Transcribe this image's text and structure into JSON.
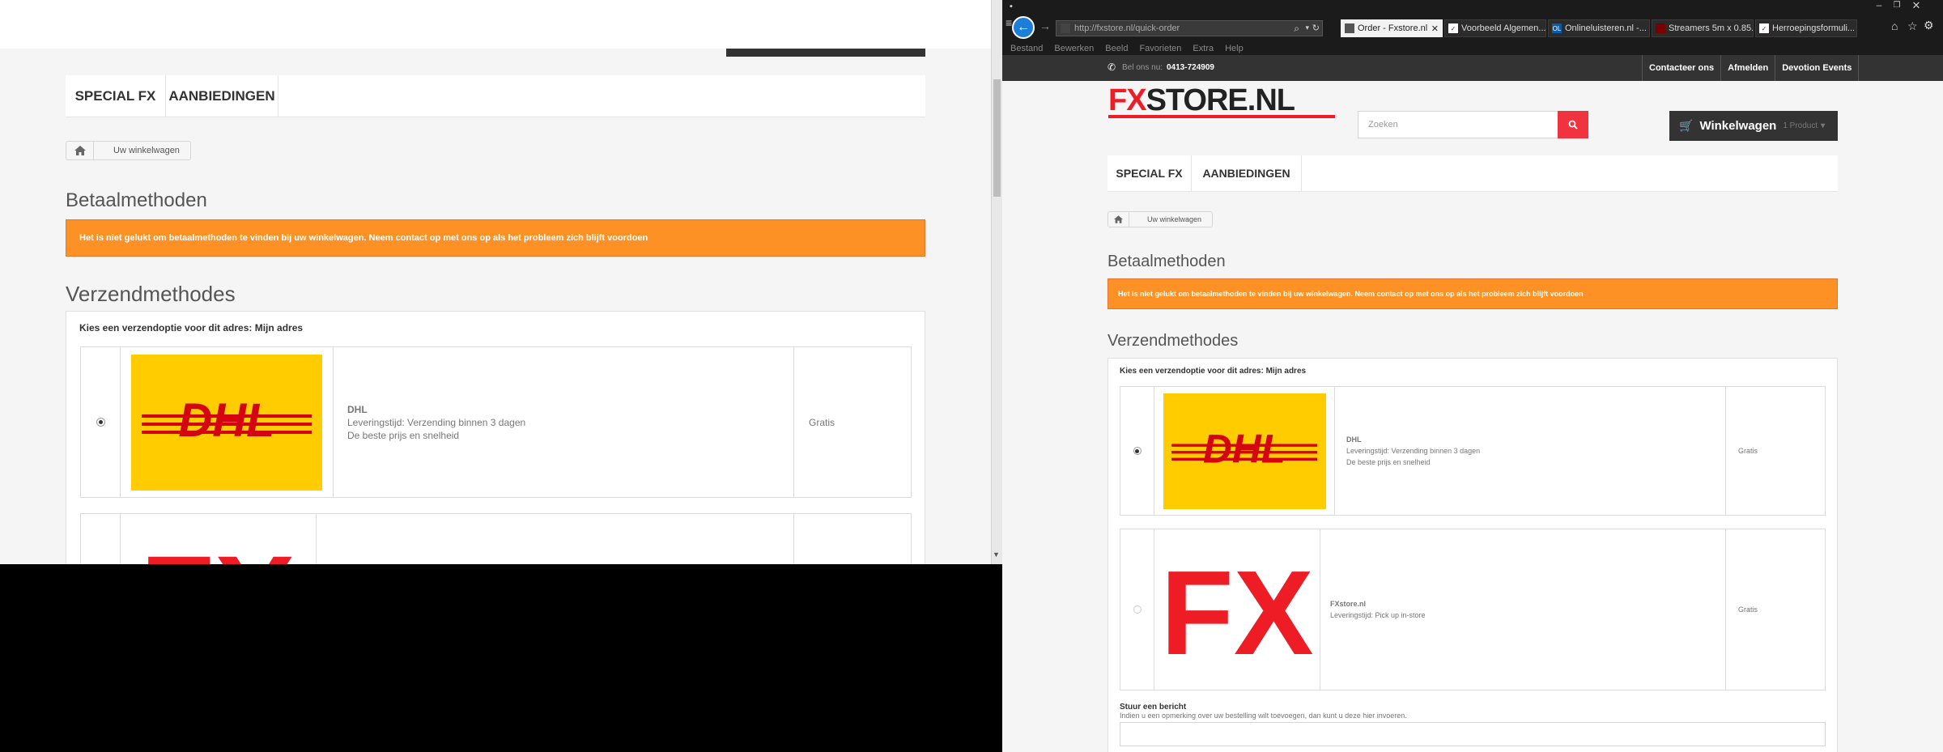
{
  "browser": {
    "url": "http://fxstore.nl/quick-order",
    "tabs": [
      {
        "label": "Order - Fxstore.nl",
        "active": true,
        "favicon": "fxstore-favicon"
      },
      {
        "label": "Voorbeeld Algemen...",
        "active": false,
        "favicon": "document-favicon"
      },
      {
        "label": "Onlineluisteren.nl -...",
        "active": false,
        "favicon": "ol-favicon"
      },
      {
        "label": "Streamers 5m x 0.85...",
        "active": false,
        "favicon": "streamers-favicon"
      },
      {
        "label": "Herroepingsformuli...",
        "active": false,
        "favicon": "document-favicon"
      }
    ],
    "menu": [
      "Bestand",
      "Bewerken",
      "Beeld",
      "Favorieten",
      "Extra",
      "Help"
    ]
  },
  "shop": {
    "phone_label": "Bel ons nu:",
    "phone": "0413-724909",
    "top_links": [
      "Contacteer ons",
      "Afmelden",
      "Devotion Events"
    ],
    "logo_fx": "FX",
    "logo_store": "STORE.NL",
    "search_placeholder": "Zoeken",
    "cart_label": "Winkelwagen",
    "cart_count": "1 Product",
    "nav": [
      "SPECIAL FX",
      "AANBIEDINGEN"
    ],
    "breadcrumb": "Uw winkelwagen"
  },
  "checkout": {
    "payment_heading": "Betaalmethoden",
    "payment_alert": "Het is niet gelukt om betaalmethoden te vinden bij uw winkelwagen. Neem contact op met ons op als het probleem zich blijft voordoen",
    "shipping_heading": "Verzendmethodes",
    "shipping_prompt": "Kies een verzendoptie voor dit adres: Mijn adres",
    "carriers": [
      {
        "name": "DHL",
        "delivery": "Leveringstijd: Verzending binnen 3 dagen",
        "note": "De beste prijs en snelheid",
        "price": "Gratis",
        "selected": true,
        "logo_text": "DHL"
      },
      {
        "name": "FXstore.nl",
        "delivery": "Leveringstijd: Pick up in-store",
        "note": "",
        "price": "Gratis",
        "selected": false,
        "logo_text": "FX"
      }
    ],
    "message_title": "Stuur een bericht",
    "message_hint": "Indien u een opmerking over uw bestelling wilt toevoegen, dan kunt u deze hier invoeren."
  },
  "colors": {
    "accent": "#f13340",
    "alert": "#fe9126",
    "dhl_yellow": "#ffcc00",
    "dhl_red": "#d40511",
    "fx_red": "#ee1c25"
  }
}
